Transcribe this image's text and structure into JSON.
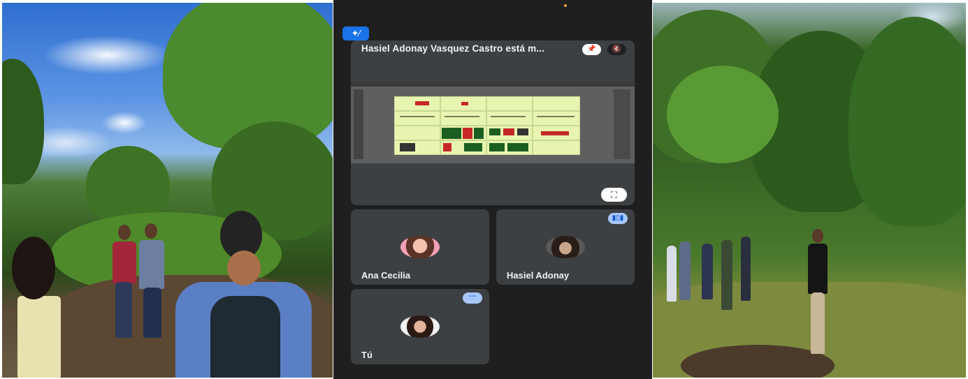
{
  "meeting": {
    "main_tile": {
      "title": "Hasiel Adonay Vasquez Castro está m...",
      "pin_icon": "pin-icon",
      "mic_icon": "mic-off-icon",
      "fullscreen_icon": "fullscreen-icon"
    },
    "effects_icon": "sparkle-wand-icon",
    "participants": [
      {
        "name": "Ana Cecilia",
        "status_icon": "none"
      },
      {
        "name": "Hasiel Adonay",
        "status_icon": "speaking-bars-icon"
      },
      {
        "name": "Tú",
        "status_icon": "more-options-icon"
      }
    ]
  },
  "colors": {
    "meet_background": "#1f1f1f",
    "tile_background": "#3c4043",
    "accent_blue": "#1a73e8",
    "speaking_badge": "#a8c7fa"
  }
}
